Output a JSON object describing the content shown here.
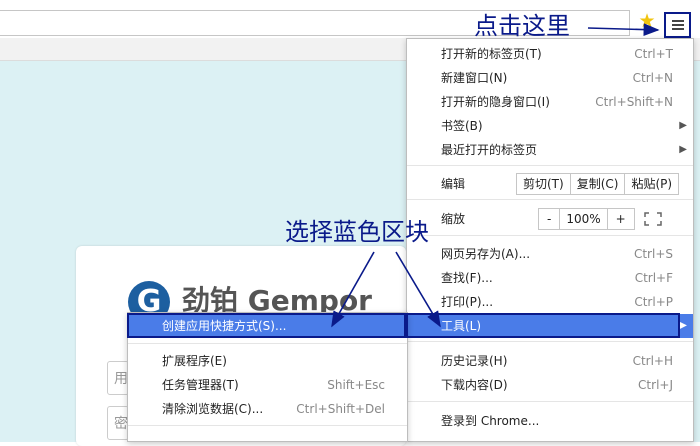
{
  "annotations": {
    "click_here": "点击这里",
    "select_blue": "选择蓝色区块"
  },
  "login": {
    "logo_letter": "G",
    "brand": "劲铂 Gempor",
    "username_placeholder": "用",
    "password_placeholder": "密"
  },
  "main_menu": {
    "new_tab": {
      "label": "打开新的标签页(T)",
      "shortcut": "Ctrl+T"
    },
    "new_window": {
      "label": "新建窗口(N)",
      "shortcut": "Ctrl+N"
    },
    "incognito": {
      "label": "打开新的隐身窗口(I)",
      "shortcut": "Ctrl+Shift+N"
    },
    "bookmarks": {
      "label": "书签(B)"
    },
    "recent_tabs": {
      "label": "最近打开的标签页"
    },
    "edit": {
      "label": "编辑",
      "cut": "剪切(T)",
      "copy": "复制(C)",
      "paste": "粘贴(P)"
    },
    "zoom": {
      "label": "缩放",
      "minus": "-",
      "value": "100%",
      "plus": "+"
    },
    "save_as": {
      "label": "网页另存为(A)...",
      "shortcut": "Ctrl+S"
    },
    "find": {
      "label": "查找(F)...",
      "shortcut": "Ctrl+F"
    },
    "print": {
      "label": "打印(P)...",
      "shortcut": "Ctrl+P"
    },
    "tools": {
      "label": "工具(L)"
    },
    "history": {
      "label": "历史记录(H)",
      "shortcut": "Ctrl+H"
    },
    "downloads": {
      "label": "下载内容(D)",
      "shortcut": "Ctrl+J"
    },
    "sign_in": {
      "label": "登录到 Chrome..."
    }
  },
  "tools_submenu": {
    "create_shortcut": {
      "label": "创建应用快捷方式(S)..."
    },
    "extensions": {
      "label": "扩展程序(E)"
    },
    "task_manager": {
      "label": "任务管理器(T)",
      "shortcut": "Shift+Esc"
    },
    "clear_data": {
      "label": "清除浏览数据(C)...",
      "shortcut": "Ctrl+Shift+Del"
    }
  },
  "colors": {
    "highlight": "#4a7ce8",
    "annotation": "#0a1a8a",
    "content_bg": "#dcf1f4"
  },
  "icons": {
    "bookmark_star": "star-icon",
    "menu": "hamburger-menu-icon",
    "fullscreen": "fullscreen-icon",
    "submenu": "chevron-right-icon"
  }
}
